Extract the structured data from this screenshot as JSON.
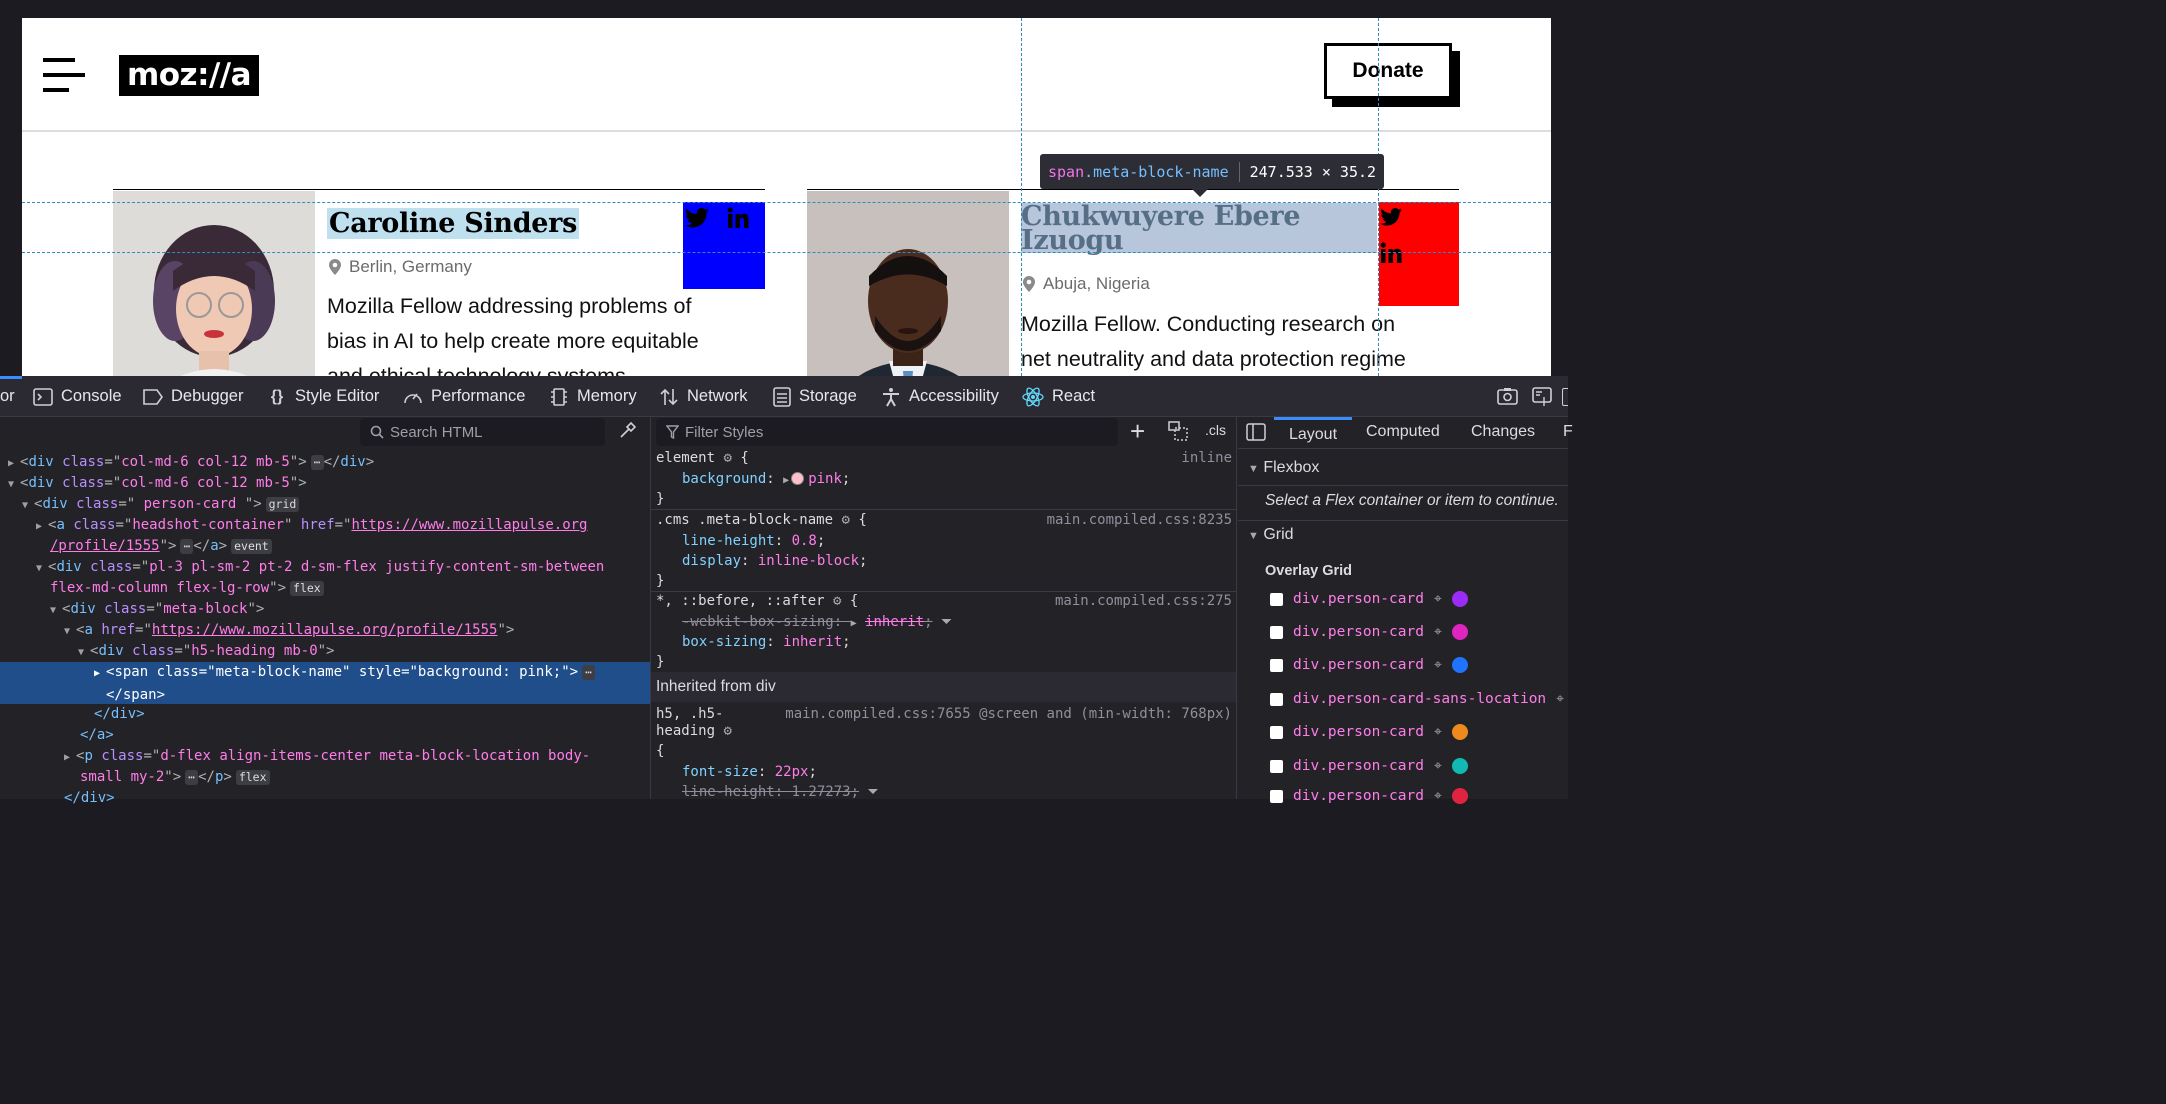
{
  "site": {
    "logo": "moz://a",
    "donate_label": "Donate"
  },
  "cards": [
    {
      "name": "Caroline Sinders",
      "location": "Berlin, Germany",
      "description": [
        "Mozilla Fellow addressing problems of",
        "bias in AI to help create more equitable",
        "and ethical technology systems"
      ],
      "social_bg": "#0000ff"
    },
    {
      "name_lines": [
        "Chukwuyere Ebere",
        "Izuogu"
      ],
      "location": "Abuja, Nigeria",
      "description": [
        "Mozilla Fellow. Conducting research on",
        "net neutrality and data protection regime"
      ],
      "social_bg": "#ff0000",
      "name_highlight": "#b7c6db"
    }
  ],
  "tooltip": {
    "tag": "span",
    "cls": ".meta-block-name",
    "dims": "247.533 × 35.2"
  },
  "devtools": {
    "tabs": [
      "or",
      "Console",
      "Debugger",
      "Style Editor",
      "Performance",
      "Memory",
      "Network",
      "Storage",
      "Accessibility",
      "React"
    ],
    "search_html_placeholder": "Search HTML",
    "filter_styles_placeholder": "Filter Styles",
    "cls_label": ".cls",
    "markup": [
      {
        "pre": "<",
        "tag": "div",
        "attr": "class",
        "val": "col-md-6 col-12 mb-5",
        "post": ">",
        "collapsed_end": "</div>"
      },
      {
        "pre": "<",
        "tag": "div",
        "attr": "class",
        "val": "col-md-6 col-12 mb-5",
        "post": ">"
      },
      {
        "pre": "<",
        "tag": "div",
        "attr": "class",
        "val": " person-card ",
        "post": ">",
        "badge": "grid"
      },
      {
        "pre": "<",
        "tag": "a",
        "attr": "class",
        "val": "headshot-container",
        "attr2": "href",
        "url1": "https://www.mozillapulse.org",
        "url2": "/profile/1555",
        "badge": "event",
        "end": "</a>"
      },
      {
        "pre": "<",
        "tag": "div",
        "attr": "class",
        "val1": "pl-3 pl-sm-2 pt-2 d-sm-flex justify-content-sm-between",
        "val2": "flex-md-column flex-lg-row",
        "badge": "flex"
      },
      {
        "pre": "<",
        "tag": "div",
        "attr": "class",
        "val": "meta-block",
        "post": ">"
      },
      {
        "pre": "<",
        "tag": "a",
        "attr": "href",
        "url": "https://www.mozillapulse.org/profile/1555",
        "post": ">"
      },
      {
        "pre": "<",
        "tag": "div",
        "attr": "class",
        "val": "h5-heading mb-0",
        "post": ">"
      },
      {
        "pre": "<",
        "tag": "span",
        "attr": "class",
        "val": "meta-block-name",
        "attr2": "style",
        "val2": "background: pink;",
        "end": "</span>"
      },
      {
        "close": "</div>"
      },
      {
        "close": "</a>"
      },
      {
        "pre": "<",
        "tag": "p",
        "attr": "class",
        "val1": "d-flex align-items-center meta-block-location body-",
        "val2": "small my-2",
        "badge": "flex",
        "end": "</p>"
      },
      {
        "close": "</div>"
      }
    ],
    "rules": {
      "element_selector": "element",
      "element_source": "inline",
      "bg_prop": "background",
      "bg_val": "pink",
      "cms_selector": ".cms .meta-block-name",
      "cms_source": "main.compiled.css:8235",
      "lh_prop": "line-height",
      "lh_val": "0.8",
      "disp_prop": "display",
      "disp_val": "inline-block",
      "univ_selector": "*, ::before, ::after",
      "univ_source": "main.compiled.css:275",
      "wbs_prop": "-webkit-box-sizing",
      "wbs_val": "inherit",
      "bs_prop": "box-sizing",
      "bs_val": "inherit",
      "inherited_header": "Inherited from div",
      "h5_selector_1": "h5, .h5-",
      "h5_selector_2": "heading",
      "h5_source": "main.compiled.css:7655 @screen and (min-width: 768px)",
      "fs_prop": "font-size",
      "fs_val": "22px",
      "lh2_prop": "line-height",
      "lh2_val": "1.27273"
    },
    "layout_tabs": [
      "Layout",
      "Computed",
      "Changes",
      "F"
    ],
    "flexbox_label": "Flexbox",
    "flexbox_hint": "Select a Flex container or item to continue.",
    "grid_label": "Grid",
    "overlay_label": "Overlay Grid",
    "grid_items": [
      {
        "name": "div.person-card",
        "color": "#9b2cf7"
      },
      {
        "name": "div.person-card",
        "color": "#e024c0"
      },
      {
        "name": "div.person-card",
        "color": "#1f73ff"
      },
      {
        "name": "div.person-card-sans-location",
        "color": "#e6a7ff"
      },
      {
        "name": "div.person-card",
        "color": "#ee8a1d"
      },
      {
        "name": "div.person-card",
        "color": "#12b8b3"
      },
      {
        "name": "div.person-card",
        "color": "#e0243f"
      }
    ]
  }
}
